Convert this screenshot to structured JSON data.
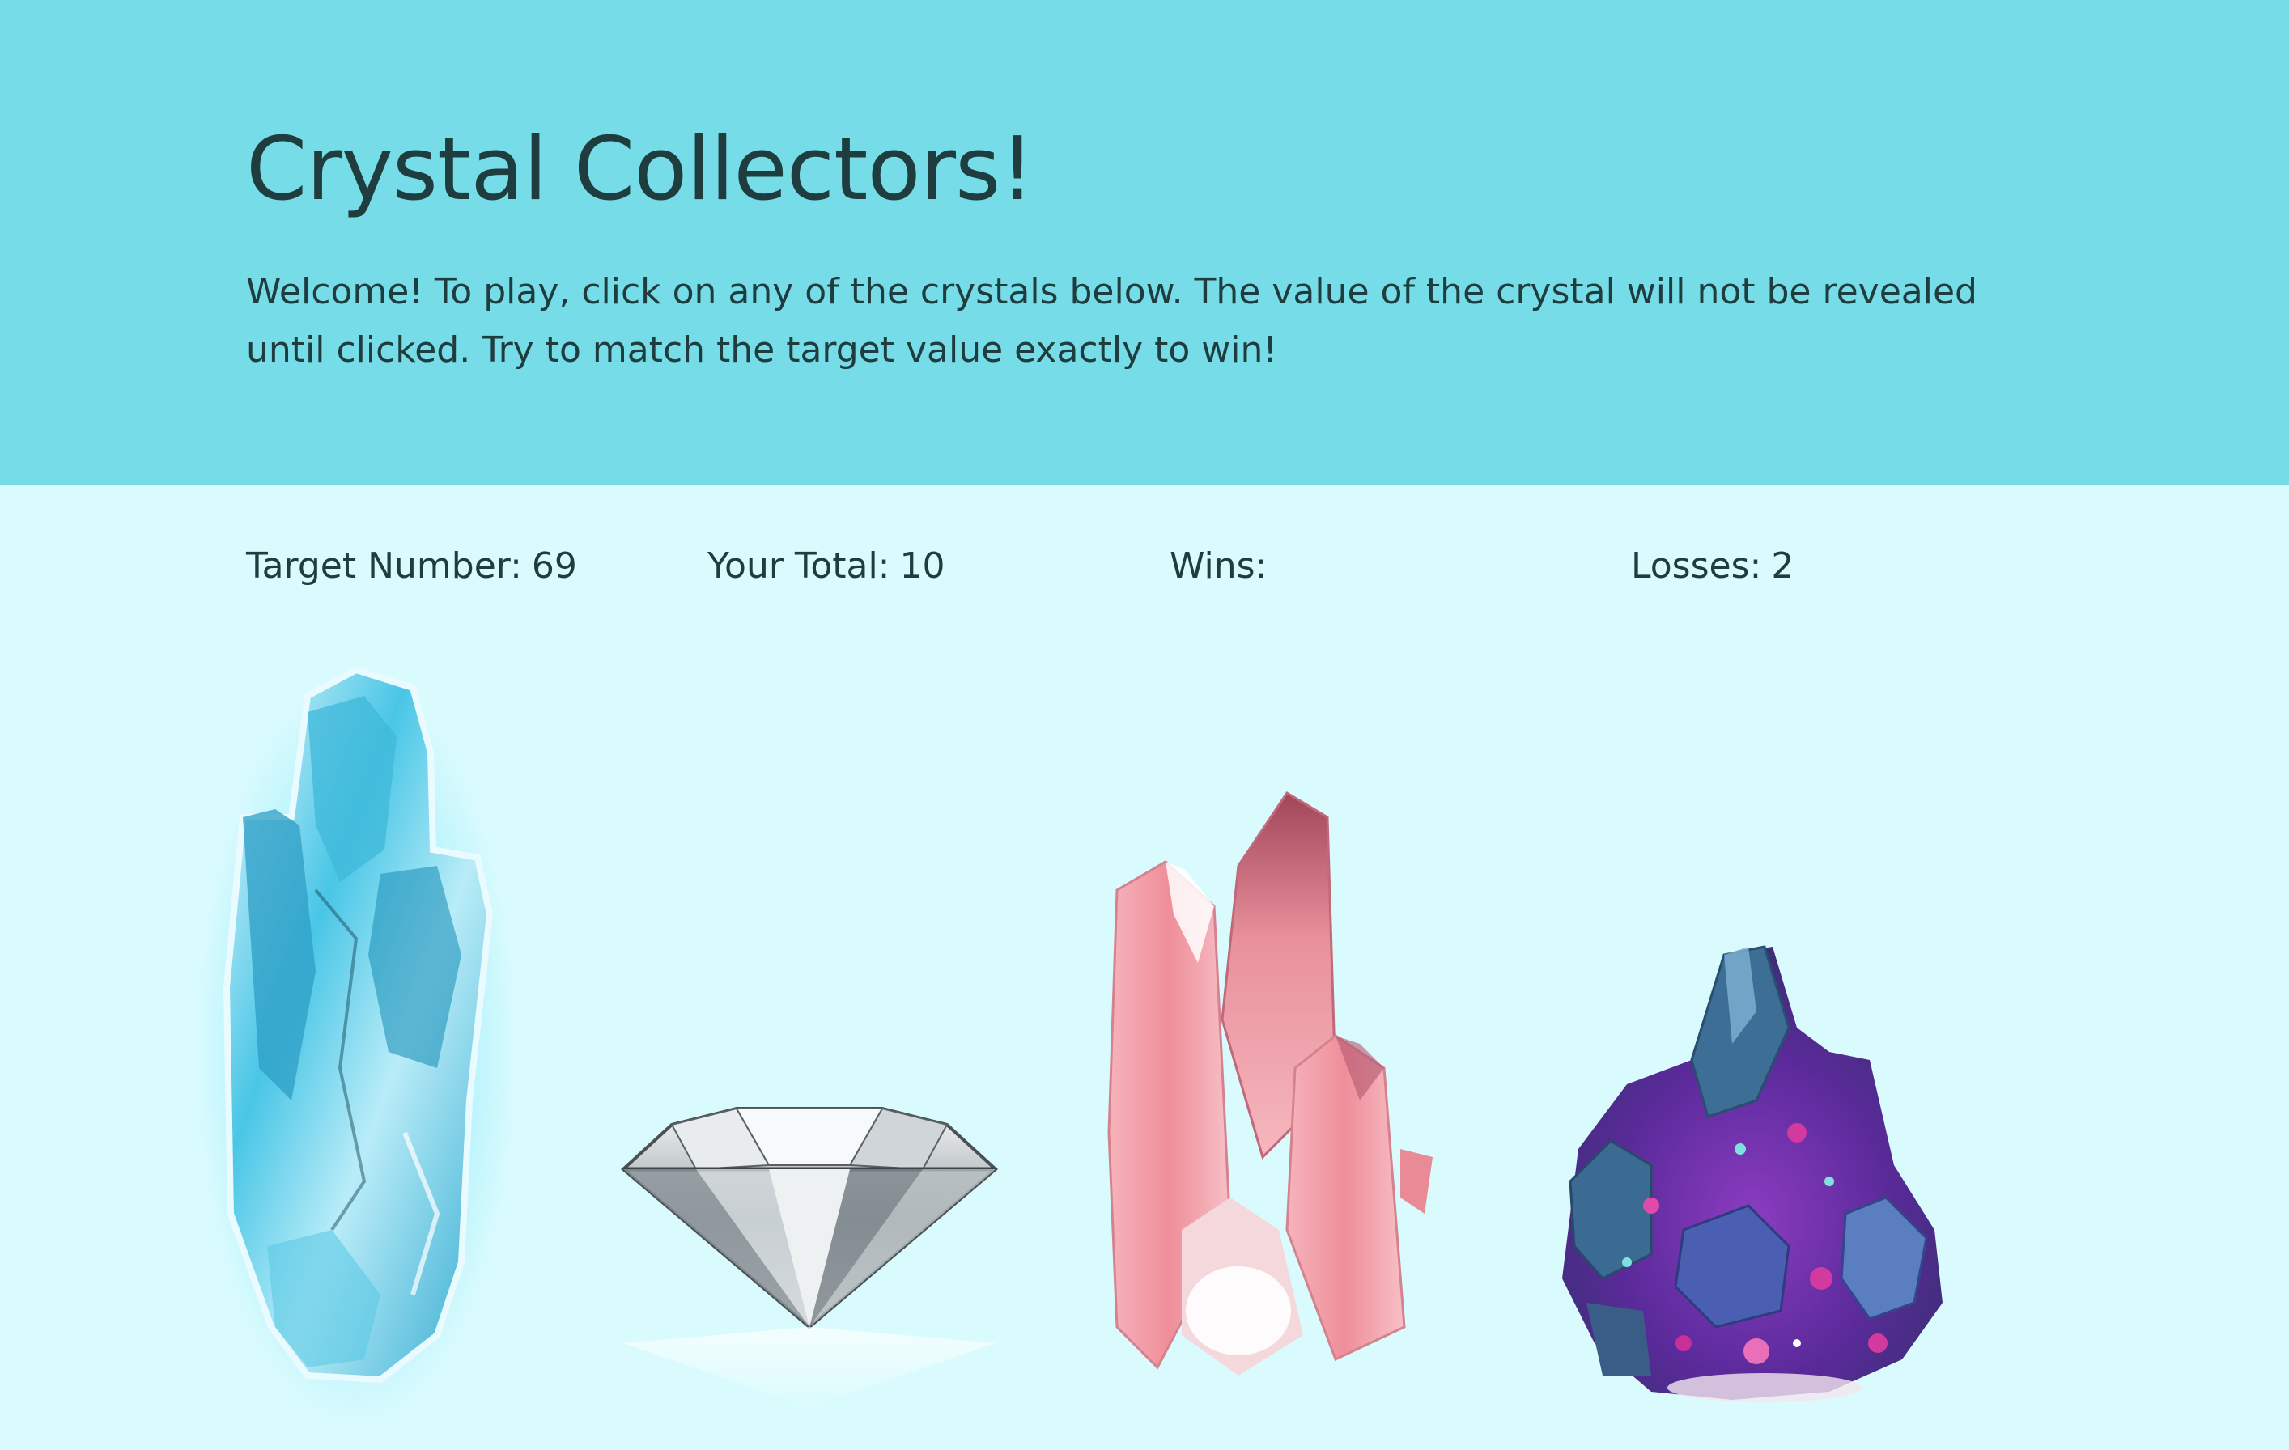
{
  "header": {
    "title": "Crystal Collectors!",
    "intro": "Welcome! To play, click on any of the crystals below. The value of the crystal will not be revealed until clicked. Try to match the target value exactly to win!"
  },
  "stats": {
    "target_label": "Target Number:",
    "target_value": "69",
    "total_label": "Your Total:",
    "total_value": "10",
    "wins_label": "Wins:",
    "wins_value": "",
    "losses_label": "Losses:",
    "losses_value": "2"
  },
  "crystals": [
    {
      "name": "blue crystal",
      "icon": "blue-crystal-icon",
      "color": "#3fc3e0"
    },
    {
      "name": "clear diamond",
      "icon": "diamond-icon",
      "color": "#b9c2c6"
    },
    {
      "name": "pink crystal",
      "icon": "pink-crystal-icon",
      "color": "#f08c98"
    },
    {
      "name": "purple crystal",
      "icon": "purple-crystal-icon",
      "color": "#5b3ea8"
    }
  ],
  "colors": {
    "header_bg": "#76dde8",
    "page_bg": "#dafbfd",
    "text": "#1f3d3f"
  }
}
